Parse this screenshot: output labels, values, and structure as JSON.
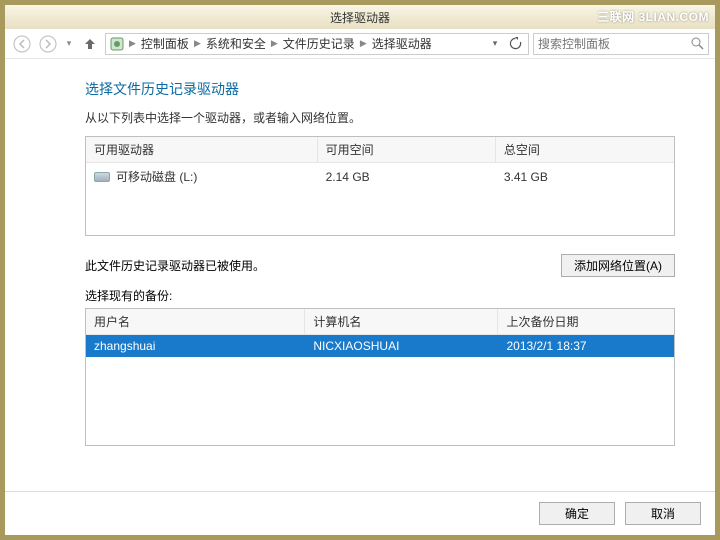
{
  "window": {
    "title": "选择驱动器"
  },
  "watermark": "三联网  3LIAN.COM",
  "breadcrumb": {
    "items": [
      "控制面板",
      "系统和安全",
      "文件历史记录",
      "选择驱动器"
    ]
  },
  "search": {
    "placeholder": "搜索控制面板"
  },
  "page": {
    "heading": "选择文件历史记录驱动器",
    "instruction": "从以下列表中选择一个驱动器，或者输入网络位置。"
  },
  "drives": {
    "headers": {
      "name": "可用驱动器",
      "free": "可用空间",
      "total": "总空间"
    },
    "rows": [
      {
        "name": "可移动磁盘 (L:)",
        "free": "2.14 GB",
        "total": "3.41 GB"
      }
    ]
  },
  "status_note": "此文件历史记录驱动器已被使用。",
  "add_network_btn": "添加网络位置(A)",
  "backups": {
    "label": "选择现有的备份:",
    "headers": {
      "user": "用户名",
      "computer": "计算机名",
      "date": "上次备份日期"
    },
    "rows": [
      {
        "user": "zhangshuai",
        "computer": "NICXIAOSHUAI",
        "date": "2013/2/1 18:37"
      }
    ]
  },
  "buttons": {
    "ok": "确定",
    "cancel": "取消"
  }
}
